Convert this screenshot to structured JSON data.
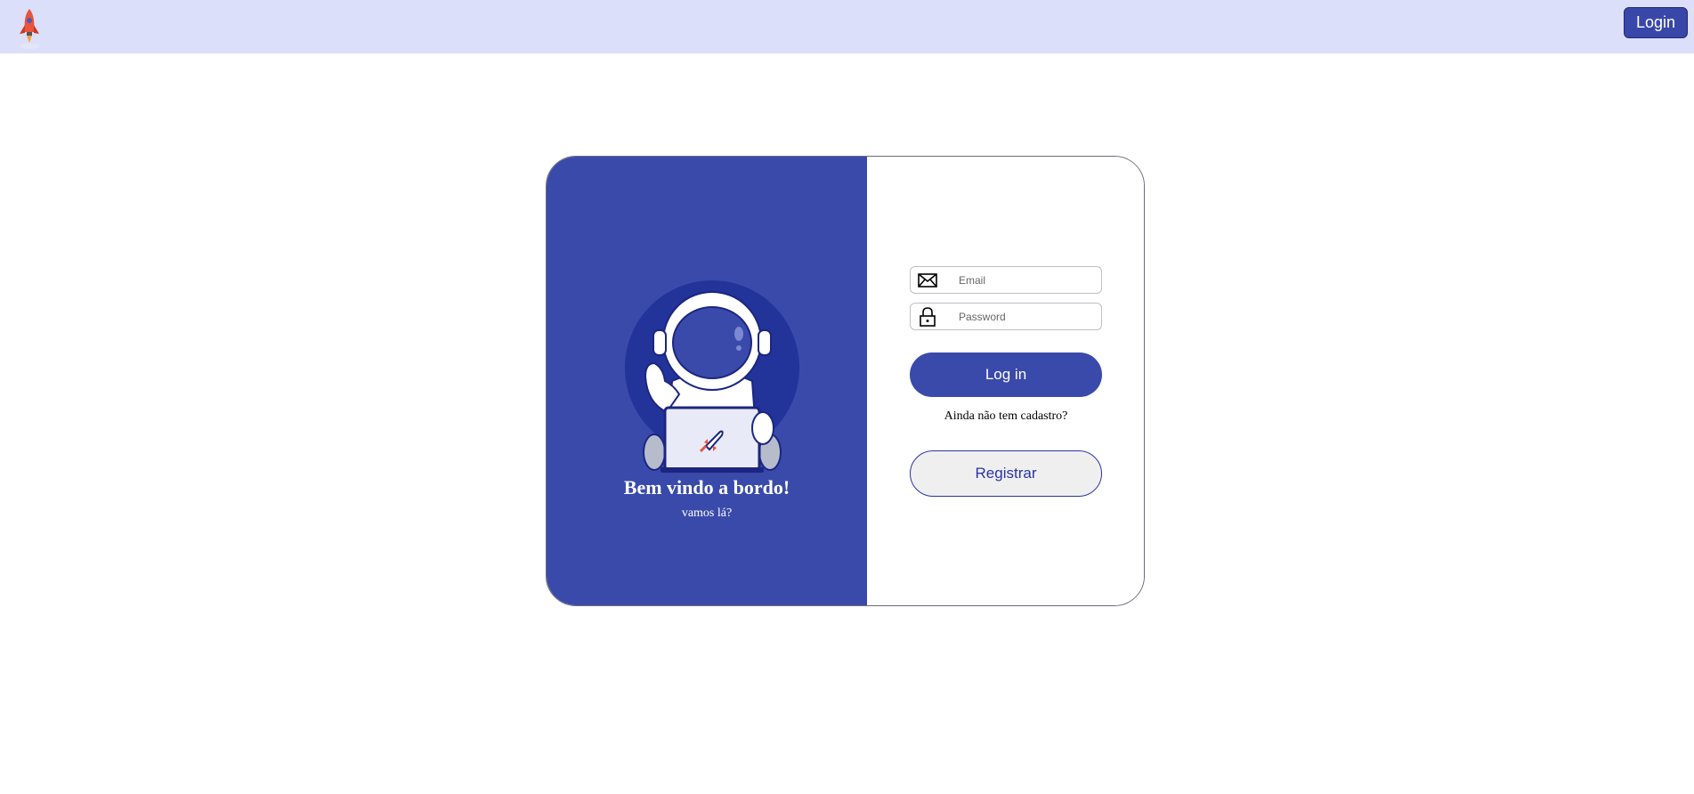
{
  "navbar": {
    "logo_icon": "rocket-icon",
    "login_label": "Login"
  },
  "welcome": {
    "illustration": "astronaut-with-laptop",
    "title": "Bem vindo a bordo!",
    "subtitle": "vamos lá?"
  },
  "form": {
    "email": {
      "icon": "envelope-icon",
      "placeholder": "Email",
      "value": ""
    },
    "password": {
      "icon": "lock-icon",
      "placeholder": "Password",
      "value": ""
    },
    "login_button": "Log in",
    "no_account_text": "Ainda não tem cadastro?",
    "register_button": "Registrar"
  },
  "colors": {
    "navbar_bg": "#dcdff9",
    "primary": "#3a4aab",
    "register_bg": "#efefef"
  }
}
